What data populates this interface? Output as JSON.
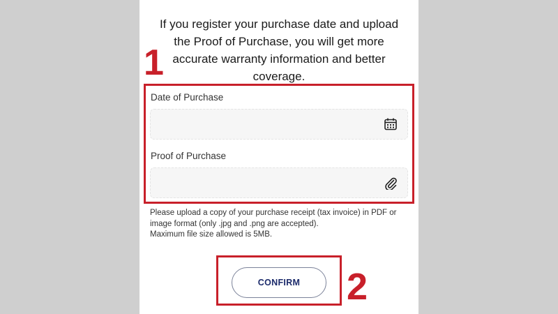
{
  "intro_text": "If you register your purchase date and upload the Proof of Purchase, you will get more accurate warranty information and better coverage.",
  "step_labels": {
    "first": "1",
    "second": "2"
  },
  "form": {
    "date_label": "Date of Purchase",
    "date_value": "",
    "date_icon": "calendar-icon",
    "proof_label": "Proof of Purchase",
    "proof_value": "",
    "proof_icon": "paperclip-icon"
  },
  "help_text": {
    "line1": "Please upload a copy of your purchase receipt (tax invoice) in PDF or",
    "line2": "image format (only .jpg and .png are accepted).",
    "line3": "Maximum file size allowed is 5MB."
  },
  "confirm_label": "CONFIRM",
  "colors": {
    "annotation_red": "#c8202a",
    "button_text": "#1c2b6b",
    "background_gray": "#cfcfcf"
  }
}
